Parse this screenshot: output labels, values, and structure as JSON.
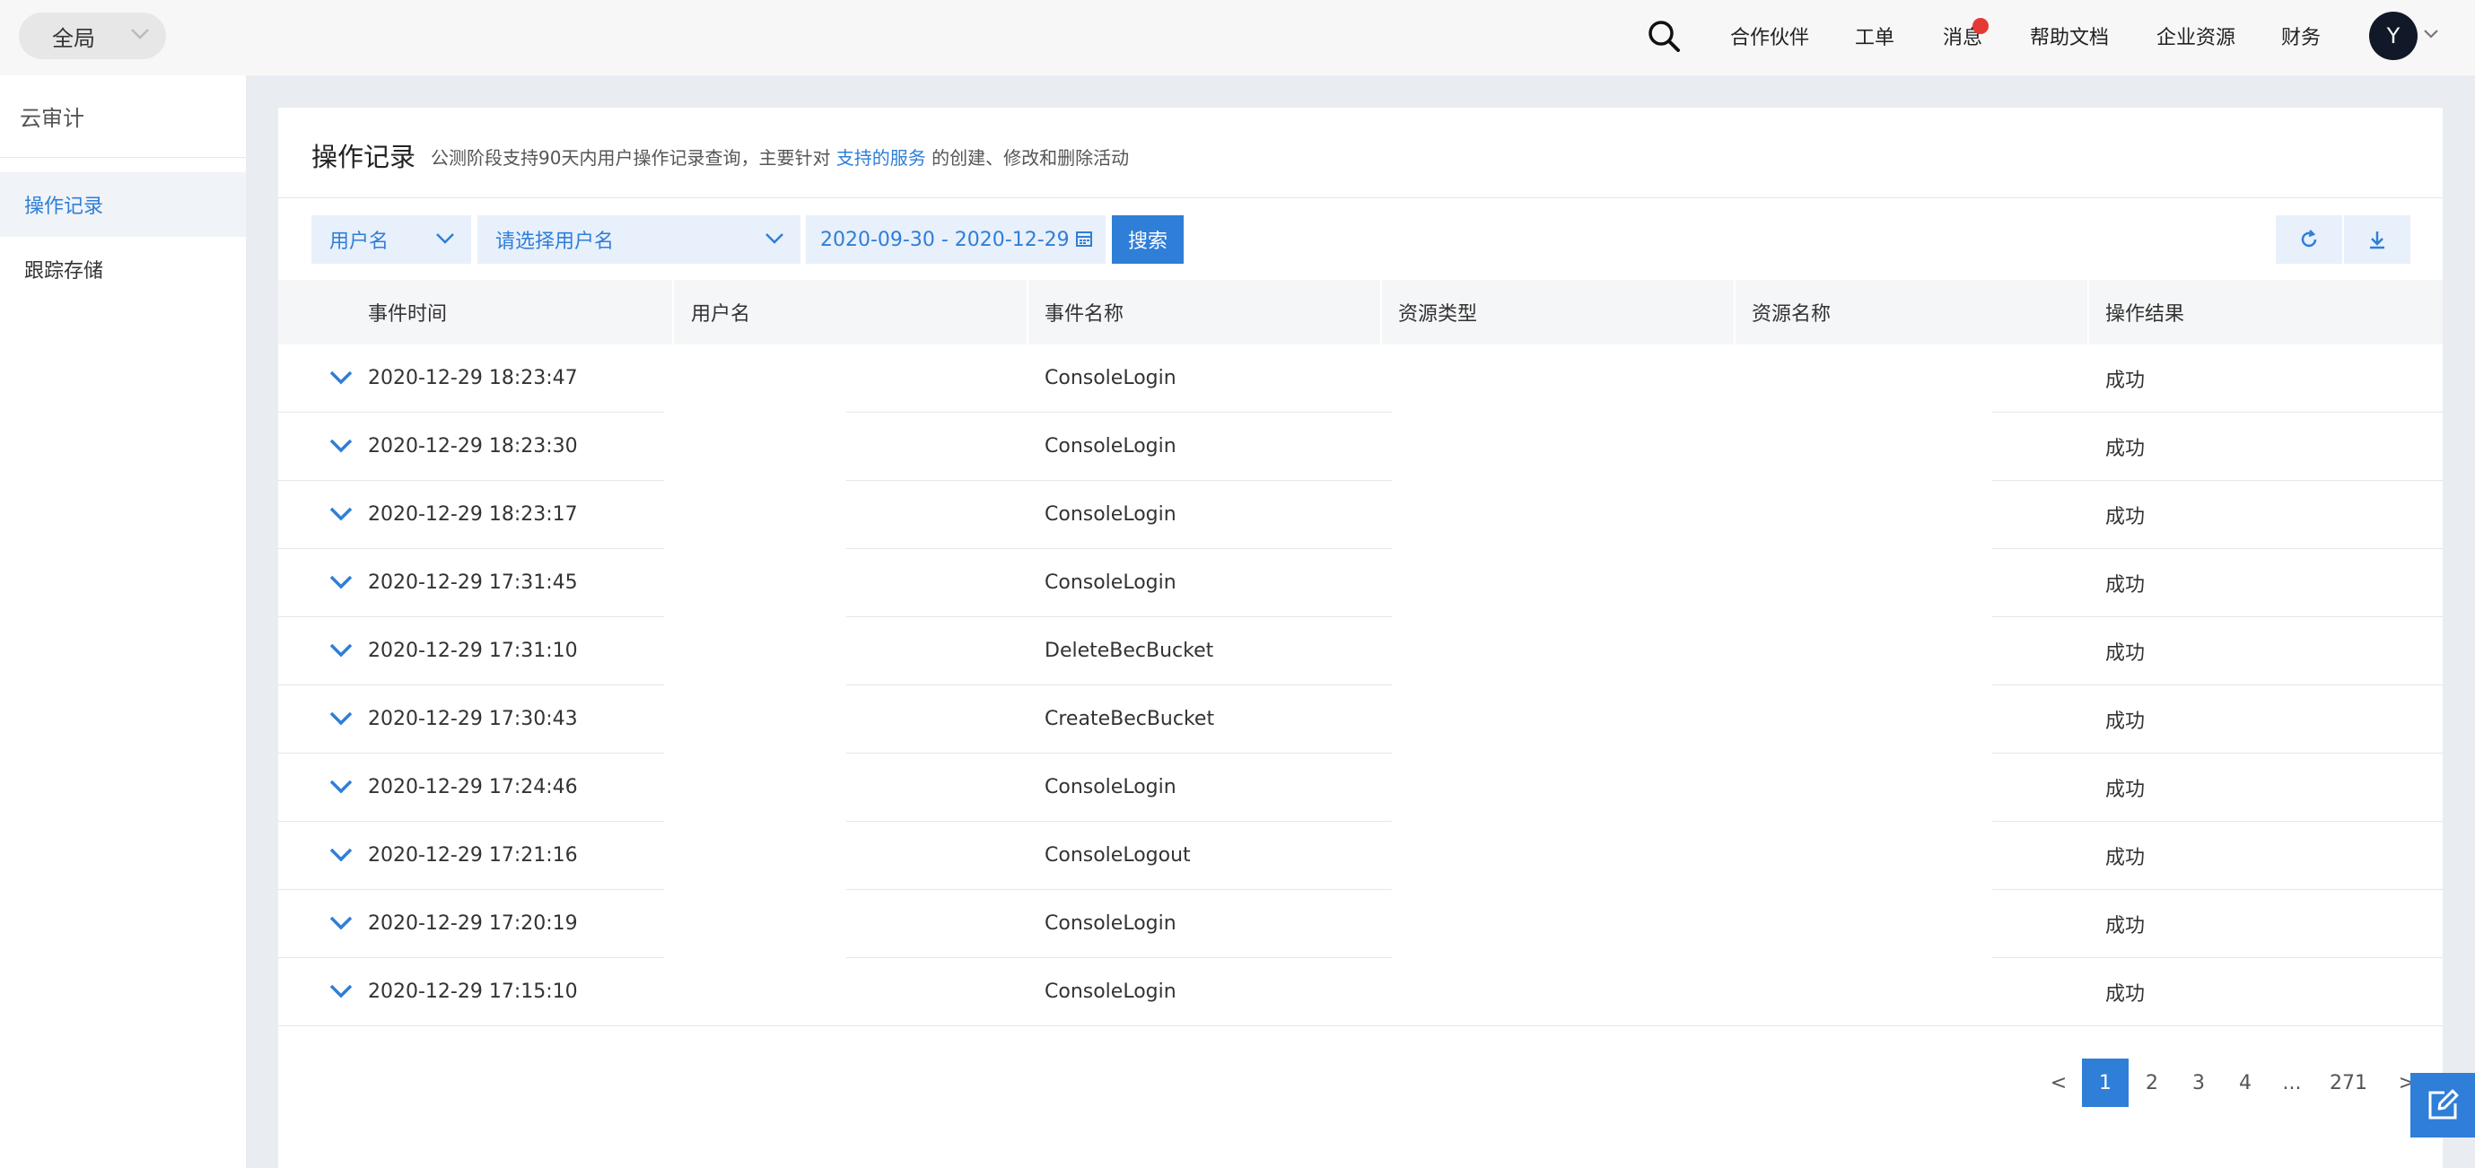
{
  "topbar": {
    "scope": "全局",
    "nav": [
      "合作伙伴",
      "工单",
      "消息",
      "帮助文档",
      "企业资源",
      "财务"
    ],
    "avatar_letter": "Y"
  },
  "sidebar": {
    "title": "云审计",
    "items": [
      {
        "label": "操作记录",
        "active": true
      },
      {
        "label": "跟踪存储",
        "active": false
      }
    ]
  },
  "page": {
    "title": "操作记录",
    "desc_prefix": "公测阶段支持90天内用户操作记录查询，主要针对",
    "desc_link": "支持的服务",
    "desc_suffix": "的创建、修改和删除活动"
  },
  "filters": {
    "field_select": "用户名",
    "user_select_placeholder": "请选择用户名",
    "date_range": "2020-09-30 - 2020-12-29",
    "search_label": "搜索"
  },
  "table": {
    "columns": [
      "事件时间",
      "用户名",
      "事件名称",
      "资源类型",
      "资源名称",
      "操作结果"
    ],
    "rows": [
      {
        "time": "2020-12-29 18:23:47",
        "user": "",
        "event": "ConsoleLogin",
        "res_type": "",
        "res_name": "",
        "result": "成功"
      },
      {
        "time": "2020-12-29 18:23:30",
        "user": "",
        "event": "ConsoleLogin",
        "res_type": "",
        "res_name": "",
        "result": "成功"
      },
      {
        "time": "2020-12-29 18:23:17",
        "user": "",
        "event": "ConsoleLogin",
        "res_type": "",
        "res_name": "",
        "result": "成功"
      },
      {
        "time": "2020-12-29 17:31:45",
        "user": "",
        "event": "ConsoleLogin",
        "res_type": "",
        "res_name": "",
        "result": "成功"
      },
      {
        "time": "2020-12-29 17:31:10",
        "user": "",
        "event": "DeleteBecBucket",
        "res_type": "",
        "res_name": "",
        "result": "成功"
      },
      {
        "time": "2020-12-29 17:30:43",
        "user": "",
        "event": "CreateBecBucket",
        "res_type": "",
        "res_name": "",
        "result": "成功"
      },
      {
        "time": "2020-12-29 17:24:46",
        "user": "",
        "event": "ConsoleLogin",
        "res_type": "",
        "res_name": "",
        "result": "成功"
      },
      {
        "time": "2020-12-29 17:21:16",
        "user": "",
        "event": "ConsoleLogout",
        "res_type": "",
        "res_name": "",
        "result": "成功"
      },
      {
        "time": "2020-12-29 17:20:19",
        "user": "",
        "event": "ConsoleLogin",
        "res_type": "",
        "res_name": "",
        "result": "成功"
      },
      {
        "time": "2020-12-29 17:15:10",
        "user": "",
        "event": "ConsoleLogin",
        "res_type": "",
        "res_name": "",
        "result": "成功"
      }
    ]
  },
  "pagination": {
    "prev": "<",
    "pages": [
      "1",
      "2",
      "3",
      "4",
      "...",
      "271"
    ],
    "current": "1",
    "next": ">"
  },
  "colors": {
    "accent": "#2f7ed8",
    "accent_light": "#e8f0fb",
    "notify": "#e53935",
    "avatar_bg": "#111827"
  }
}
